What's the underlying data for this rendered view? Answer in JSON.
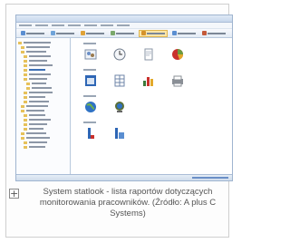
{
  "figure": {
    "caption": "System statlook - lista raportów dotyczących monitorowania pracowników. (Źródło: A plus C Systems)",
    "expand_symbol": "+"
  },
  "screenshot": {
    "accent": "#3b6fb5",
    "toolbar_buttons": [
      {
        "icon": "app-icon",
        "color": "#5a8ed1",
        "active": false
      },
      {
        "icon": "monitor-icon",
        "color": "#6fa3d9",
        "active": false
      },
      {
        "icon": "chart-icon",
        "color": "#e0a236",
        "active": false
      },
      {
        "icon": "clock-icon",
        "color": "#7aa86b",
        "active": false
      },
      {
        "icon": "reports-icon",
        "color": "#d5922a",
        "active": true
      },
      {
        "icon": "user-icon",
        "color": "#5a8ed1",
        "active": false
      },
      {
        "icon": "audit-icon",
        "color": "#c45a3a",
        "active": false
      },
      {
        "icon": "settings-icon",
        "color": "#7b8795",
        "active": false
      }
    ],
    "report_icons": [
      [
        "users-report-icon",
        "clock-report-icon",
        "document-report-icon",
        "pie-chart-report-icon"
      ],
      [
        "calendar-report-icon",
        "table-report-icon",
        "bar-chart-report-icon",
        "printer-report-icon"
      ],
      [
        "globe-report-icon",
        "network-report-icon"
      ],
      [
        "person-report-icon",
        "group-report-icon"
      ]
    ]
  }
}
